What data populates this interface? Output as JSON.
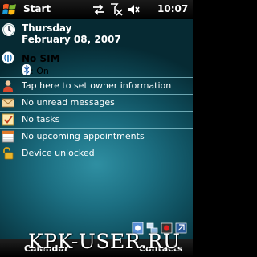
{
  "topbar": {
    "start_label": "Start",
    "time": "10:07",
    "icons": [
      "windows-flag-icon",
      "sync-arrows-icon",
      "no-signal-icon",
      "speaker-mute-icon"
    ]
  },
  "today": {
    "date_day": "Thursday",
    "date_full": "February 08, 2007",
    "sim_status": "No SIM",
    "bluetooth_status": ": On",
    "owner_info": "Tap here to set owner information",
    "messages": "No unread messages",
    "tasks": "No tasks",
    "appointments": "No upcoming appointments",
    "device_lock": "Device unlocked"
  },
  "softkeys": {
    "left": "Calendar",
    "right": "Contacts"
  },
  "watermark": "KPK-USER.RU",
  "colors": {
    "accent": "#1c6f82",
    "separator": "#8fc9d4"
  }
}
